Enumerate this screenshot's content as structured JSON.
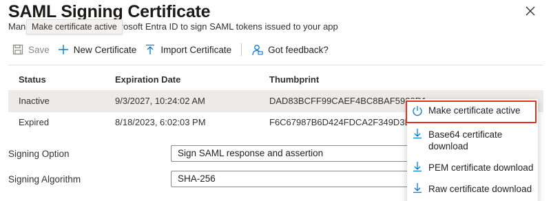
{
  "header": {
    "title": "SAML Signing Certificate",
    "subtitle_start": "Mana",
    "subtitle_rest": "Microsoft Entra ID to sign SAML tokens issued to your app",
    "tooltip": "Make certificate active",
    "close_icon": "close-icon"
  },
  "toolbar": {
    "save_label": "Save",
    "new_certificate_label": "New Certificate",
    "import_certificate_label": "Import Certificate",
    "feedback_label": "Got feedback?"
  },
  "table": {
    "columns": [
      "Status",
      "Expiration Date",
      "Thumbprint"
    ],
    "rows": [
      {
        "status": "Inactive",
        "expiration": "9/3/2027, 10:24:02 AM",
        "thumbprint": "DAD83BCFF99CAEF4BC8BAF5930D1...",
        "selected": true
      },
      {
        "status": "Expired",
        "expiration": "8/18/2023, 6:02:03 PM",
        "thumbprint": "F6C67987B6D424FDCA2F349D3D9F...",
        "selected": false
      }
    ]
  },
  "form": {
    "signing_option_label": "Signing Option",
    "signing_option_value": "Sign SAML response and assertion",
    "signing_algorithm_label": "Signing Algorithm",
    "signing_algorithm_value": "SHA-256"
  },
  "context_menu": {
    "items": [
      {
        "label": "Make certificate active",
        "icon": "power-icon"
      },
      {
        "label_line1": "Base64 certificate",
        "label_line2": "download",
        "icon": "download-icon"
      },
      {
        "label": "PEM certificate download",
        "icon": "download-icon"
      },
      {
        "label": "Raw certificate download",
        "icon": "download-icon"
      }
    ]
  },
  "colors": {
    "accent": "#0078d4",
    "highlight_border": "#e0321e",
    "selected_row": "#edebe9"
  }
}
